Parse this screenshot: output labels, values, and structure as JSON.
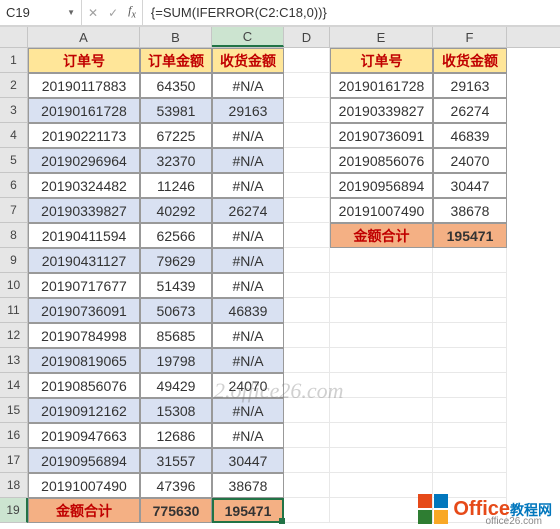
{
  "namebox": "C19",
  "formula": "{=SUM(IFERROR(C2:C18,0))}",
  "columns": [
    "A",
    "B",
    "C",
    "D",
    "E",
    "F"
  ],
  "rows": [
    "1",
    "2",
    "3",
    "4",
    "5",
    "6",
    "7",
    "8",
    "9",
    "10",
    "11",
    "12",
    "13",
    "14",
    "15",
    "16",
    "17",
    "18",
    "19"
  ],
  "left": {
    "headers": [
      "订单号",
      "订单金额",
      "收货金额"
    ],
    "data": [
      {
        "id": "20190117883",
        "amt": "64350",
        "recv": "#N/A"
      },
      {
        "id": "20190161728",
        "amt": "53981",
        "recv": "29163"
      },
      {
        "id": "20190221173",
        "amt": "67225",
        "recv": "#N/A"
      },
      {
        "id": "20190296964",
        "amt": "32370",
        "recv": "#N/A"
      },
      {
        "id": "20190324482",
        "amt": "11246",
        "recv": "#N/A"
      },
      {
        "id": "20190339827",
        "amt": "40292",
        "recv": "26274"
      },
      {
        "id": "20190411594",
        "amt": "62566",
        "recv": "#N/A"
      },
      {
        "id": "20190431127",
        "amt": "79629",
        "recv": "#N/A"
      },
      {
        "id": "20190717677",
        "amt": "51439",
        "recv": "#N/A"
      },
      {
        "id": "20190736091",
        "amt": "50673",
        "recv": "46839"
      },
      {
        "id": "20190784998",
        "amt": "85685",
        "recv": "#N/A"
      },
      {
        "id": "20190819065",
        "amt": "19798",
        "recv": "#N/A"
      },
      {
        "id": "20190856076",
        "amt": "49429",
        "recv": "24070"
      },
      {
        "id": "20190912162",
        "amt": "15308",
        "recv": "#N/A"
      },
      {
        "id": "20190947663",
        "amt": "12686",
        "recv": "#N/A"
      },
      {
        "id": "20190956894",
        "amt": "31557",
        "recv": "30447"
      },
      {
        "id": "20191007490",
        "amt": "47396",
        "recv": "38678"
      }
    ],
    "sum": {
      "label": "金额合计",
      "amt": "775630",
      "recv": "195471"
    }
  },
  "right": {
    "headers": [
      "订单号",
      "收货金额"
    ],
    "data": [
      {
        "id": "20190161728",
        "recv": "29163"
      },
      {
        "id": "20190339827",
        "recv": "26274"
      },
      {
        "id": "20190736091",
        "recv": "46839"
      },
      {
        "id": "20190856076",
        "recv": "24070"
      },
      {
        "id": "20190956894",
        "recv": "30447"
      },
      {
        "id": "20191007490",
        "recv": "38678"
      }
    ],
    "sum": {
      "label": "金额合计",
      "recv": "195471"
    }
  },
  "watermark": "2.office26.com",
  "logo": {
    "brand": "Office",
    "sub": "教程网",
    "url": "office26.com"
  }
}
